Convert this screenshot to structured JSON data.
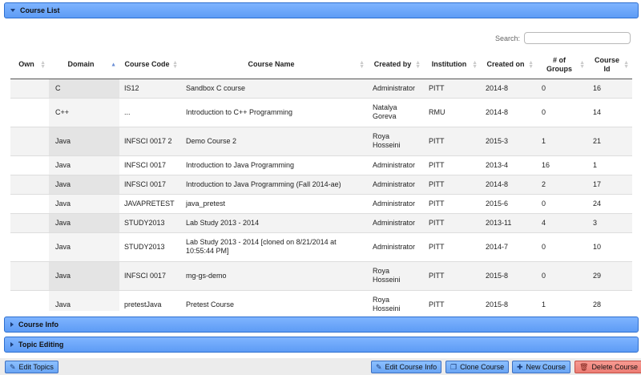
{
  "course_list": {
    "title": "Course List"
  },
  "search": {
    "label": "Search:",
    "value": ""
  },
  "table": {
    "headers": [
      "Own",
      "Domain",
      "Course Code",
      "Course Name",
      "Created by",
      "Institution",
      "Created on",
      "# of Groups",
      "Course Id"
    ],
    "rows": [
      [
        "",
        "C",
        "IS12",
        "Sandbox C course",
        "Administrator",
        "PITT",
        "2014-8",
        "0",
        "16"
      ],
      [
        "",
        "C++",
        "...",
        "Introduction to C++ Programming",
        "Natalya Goreva",
        "RMU",
        "2014-8",
        "0",
        "14"
      ],
      [
        "",
        "Java",
        "INFSCI 0017 2",
        "Demo Course 2",
        "Roya Hosseini",
        "PITT",
        "2015-3",
        "1",
        "21"
      ],
      [
        "",
        "Java",
        "INFSCI 0017",
        "Introduction to Java Programming",
        "Administrator",
        "PITT",
        "2013-4",
        "16",
        "1"
      ],
      [
        "",
        "Java",
        "INFSCI 0017",
        "Introduction to Java Programming (Fall 2014-ae)",
        "Administrator",
        "PITT",
        "2014-8",
        "2",
        "17"
      ],
      [
        "",
        "Java",
        "JAVAPRETEST",
        "java_pretest",
        "Administrator",
        "PITT",
        "2015-6",
        "0",
        "24"
      ],
      [
        "",
        "Java",
        "STUDY2013",
        "Lab Study 2013 - 2014",
        "Administrator",
        "PITT",
        "2013-11",
        "4",
        "3"
      ],
      [
        "",
        "Java",
        "STUDY2013",
        "Lab Study 2013 - 2014 [cloned on 8/21/2014 at 10:55:44 PM]",
        "Administrator",
        "PITT",
        "2014-7",
        "0",
        "10"
      ],
      [
        "",
        "Java",
        "INFSCI 0017",
        "mg-gs-demo",
        "Roya Hosseini",
        "PITT",
        "2015-8",
        "0",
        "29"
      ],
      [
        "",
        "Java",
        "pretestJava",
        "Pretest Course",
        "Roya Hosseini",
        "PITT",
        "2015-8",
        "1",
        "28"
      ]
    ]
  },
  "course_info": {
    "title": "Course Info"
  },
  "topic_editing": {
    "title": "Topic Editing"
  },
  "buttons": {
    "edit_topics": "Edit Topics",
    "edit_course_info": "Edit Course Info",
    "clone_course": "Clone Course",
    "new_course": "New Course",
    "delete_course": "Delete Course"
  },
  "colors": {
    "header_blue": "#6aa5f4",
    "delete_red": "#ec7d74"
  }
}
